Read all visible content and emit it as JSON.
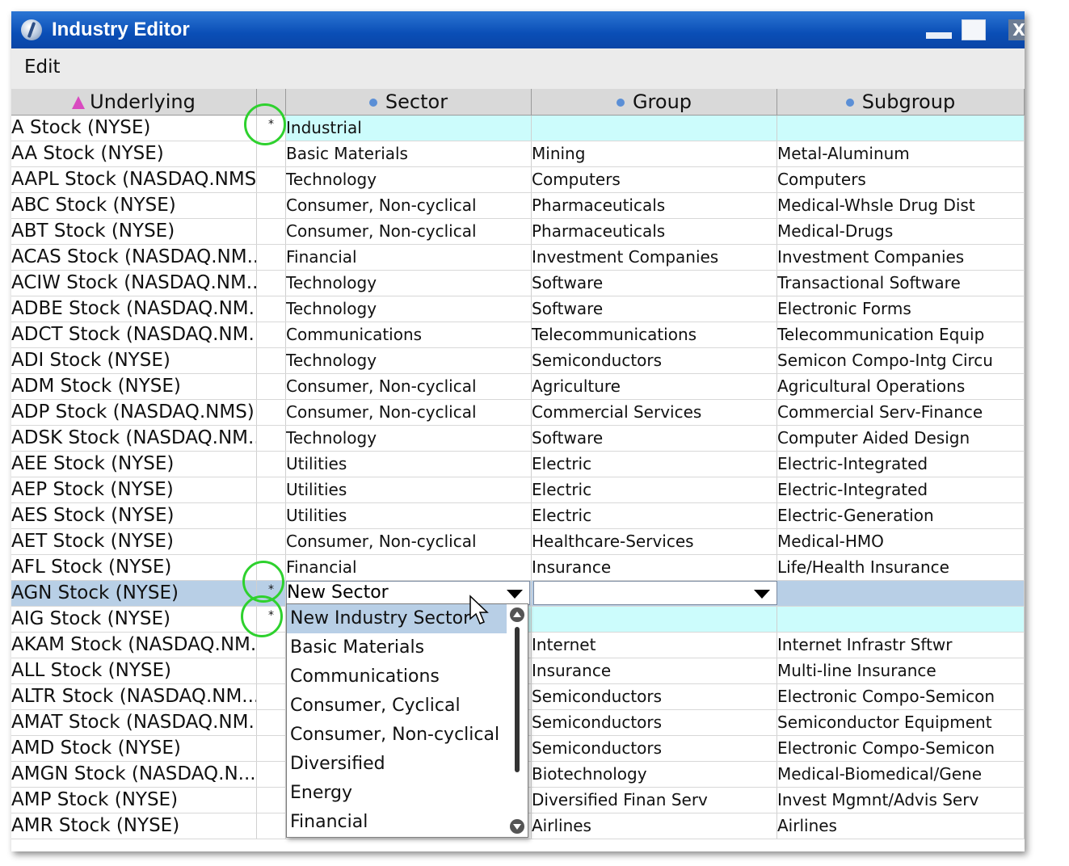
{
  "window": {
    "title": "Industry Editor",
    "menu": {
      "edit": "Edit"
    },
    "controls": {
      "close": "X"
    }
  },
  "columns": {
    "underlying": "Underlying",
    "sector": "Sector",
    "group": "Group",
    "subgroup": "Subgroup"
  },
  "rows": [
    {
      "underlying": "A Stock (NYSE)",
      "flag": "*",
      "sector": "Industrial",
      "group": "",
      "subgroup": ""
    },
    {
      "underlying": "AA Stock (NYSE)",
      "flag": "",
      "sector": "Basic Materials",
      "group": "Mining",
      "subgroup": "Metal-Aluminum"
    },
    {
      "underlying": "AAPL Stock (NASDAQ.NMS)",
      "flag": "",
      "sector": "Technology",
      "group": "Computers",
      "subgroup": "Computers"
    },
    {
      "underlying": "ABC Stock (NYSE)",
      "flag": "",
      "sector": "Consumer, Non-cyclical",
      "group": "Pharmaceuticals",
      "subgroup": "Medical-Whsle Drug Dist"
    },
    {
      "underlying": "ABT Stock (NYSE)",
      "flag": "",
      "sector": "Consumer, Non-cyclical",
      "group": "Pharmaceuticals",
      "subgroup": "Medical-Drugs"
    },
    {
      "underlying": "ACAS Stock (NASDAQ.NM...",
      "flag": "",
      "sector": "Financial",
      "group": "Investment Companies",
      "subgroup": "Investment Companies"
    },
    {
      "underlying": "ACIW Stock (NASDAQ.NM...",
      "flag": "",
      "sector": "Technology",
      "group": "Software",
      "subgroup": "Transactional Software"
    },
    {
      "underlying": "ADBE Stock (NASDAQ.NM...",
      "flag": "",
      "sector": "Technology",
      "group": "Software",
      "subgroup": "Electronic Forms"
    },
    {
      "underlying": "ADCT Stock (NASDAQ.NM...",
      "flag": "",
      "sector": "Communications",
      "group": "Telecommunications",
      "subgroup": "Telecommunication Equip"
    },
    {
      "underlying": "ADI Stock (NYSE)",
      "flag": "",
      "sector": "Technology",
      "group": "Semiconductors",
      "subgroup": "Semicon Compo-Intg Circu"
    },
    {
      "underlying": "ADM Stock (NYSE)",
      "flag": "",
      "sector": "Consumer, Non-cyclical",
      "group": "Agriculture",
      "subgroup": "Agricultural Operations"
    },
    {
      "underlying": "ADP Stock (NASDAQ.NMS)",
      "flag": "",
      "sector": "Consumer, Non-cyclical",
      "group": "Commercial Services",
      "subgroup": "Commercial Serv-Finance"
    },
    {
      "underlying": "ADSK Stock (NASDAQ.NM...",
      "flag": "",
      "sector": "Technology",
      "group": "Software",
      "subgroup": "Computer Aided Design"
    },
    {
      "underlying": "AEE Stock (NYSE)",
      "flag": "",
      "sector": "Utilities",
      "group": "Electric",
      "subgroup": "Electric-Integrated"
    },
    {
      "underlying": "AEP Stock (NYSE)",
      "flag": "",
      "sector": "Utilities",
      "group": "Electric",
      "subgroup": "Electric-Integrated"
    },
    {
      "underlying": "AES Stock (NYSE)",
      "flag": "",
      "sector": "Utilities",
      "group": "Electric",
      "subgroup": "Electric-Generation"
    },
    {
      "underlying": "AET Stock (NYSE)",
      "flag": "",
      "sector": "Consumer, Non-cyclical",
      "group": "Healthcare-Services",
      "subgroup": "Medical-HMO"
    },
    {
      "underlying": "AFL Stock (NYSE)",
      "flag": "",
      "sector": "Financial",
      "group": "Insurance",
      "subgroup": "Life/Health Insurance"
    },
    {
      "underlying": "AGN Stock (NYSE)",
      "flag": "*",
      "sector": "",
      "group": "",
      "subgroup": ""
    },
    {
      "underlying": "AIG Stock (NYSE)",
      "flag": "*",
      "sector": "",
      "group": "",
      "subgroup": ""
    },
    {
      "underlying": "AKAM Stock (NASDAQ.NM...",
      "flag": "",
      "sector": "",
      "group": "Internet",
      "subgroup": "Internet Infrastr Sftwr"
    },
    {
      "underlying": "ALL Stock (NYSE)",
      "flag": "",
      "sector": "",
      "group": "Insurance",
      "subgroup": "Multi-line Insurance"
    },
    {
      "underlying": "ALTR Stock (NASDAQ.NM...",
      "flag": "",
      "sector": "",
      "group": "Semiconductors",
      "subgroup": "Electronic Compo-Semicon"
    },
    {
      "underlying": "AMAT Stock (NASDAQ.NM...",
      "flag": "",
      "sector": "",
      "group": "Semiconductors",
      "subgroup": "Semiconductor Equipment"
    },
    {
      "underlying": "AMD Stock (NYSE)",
      "flag": "",
      "sector": "",
      "group": "Semiconductors",
      "subgroup": "Electronic Compo-Semicon"
    },
    {
      "underlying": "AMGN Stock (NASDAQ.N...",
      "flag": "",
      "sector": "",
      "group": "Biotechnology",
      "subgroup": "Medical-Biomedical/Gene"
    },
    {
      "underlying": "AMP Stock (NYSE)",
      "flag": "",
      "sector": "",
      "group": "Diversified Finan Serv",
      "subgroup": "Invest Mgmnt/Advis Serv"
    },
    {
      "underlying": "AMR Stock (NYSE)",
      "flag": "",
      "sector": "",
      "group": "Airlines",
      "subgroup": "Airlines"
    }
  ],
  "editor": {
    "sector_value": "New Sector",
    "group_value": ""
  },
  "dropdown": {
    "items": [
      "New Industry Sector",
      "Basic Materials",
      "Communications",
      "Consumer, Cyclical",
      "Consumer, Non-cyclical",
      "Diversified",
      "Energy",
      "Financial"
    ],
    "highlighted_index": 0
  },
  "colors": {
    "titlebar": "#0a4eb6",
    "highlight_cyan": "#ccfcfc",
    "selected_row": "#b8cfe6",
    "marker_green": "#2ed12e",
    "sort_icon": "#d94ac0"
  }
}
